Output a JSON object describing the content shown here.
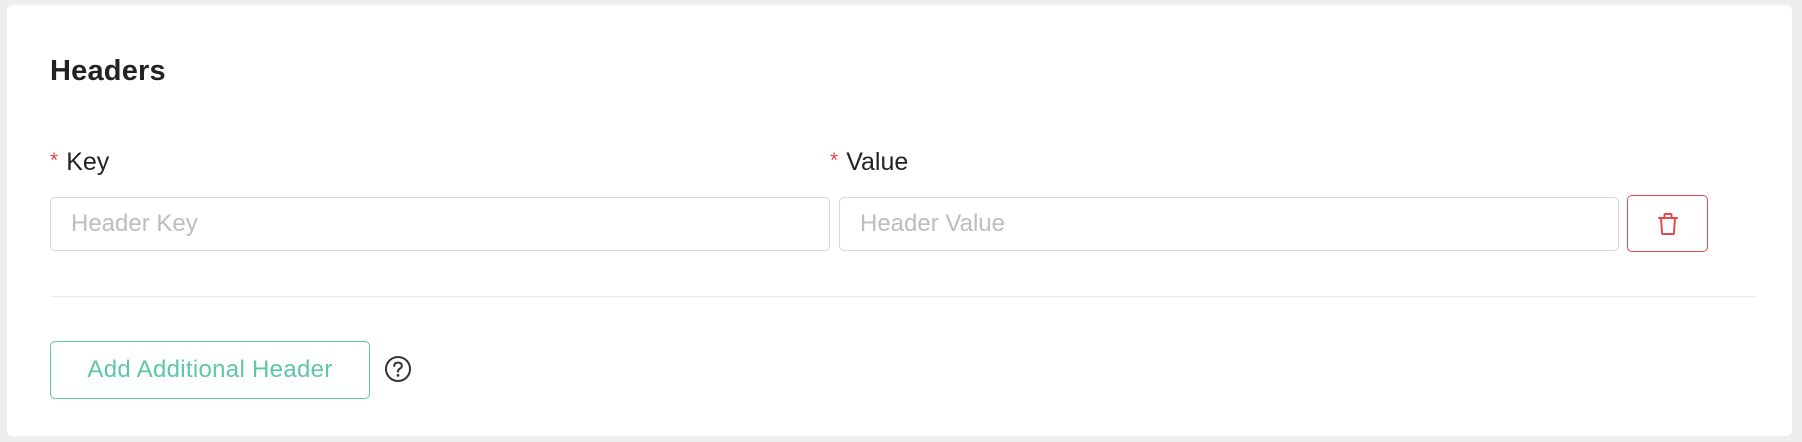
{
  "section": {
    "title": "Headers"
  },
  "fields": {
    "required_marker": "*",
    "key_label": "Key",
    "value_label": "Value",
    "key_placeholder": "Header Key",
    "value_placeholder": "Header Value",
    "key_value": "",
    "value_value": ""
  },
  "actions": {
    "delete_icon": "trash-icon",
    "add_label": "Add Additional Header",
    "help_icon": "question-circle-icon"
  },
  "colors": {
    "required": "#e5484d",
    "delete": "#e5484d",
    "accent": "#5ec7a8",
    "border": "#d9d9d9"
  }
}
